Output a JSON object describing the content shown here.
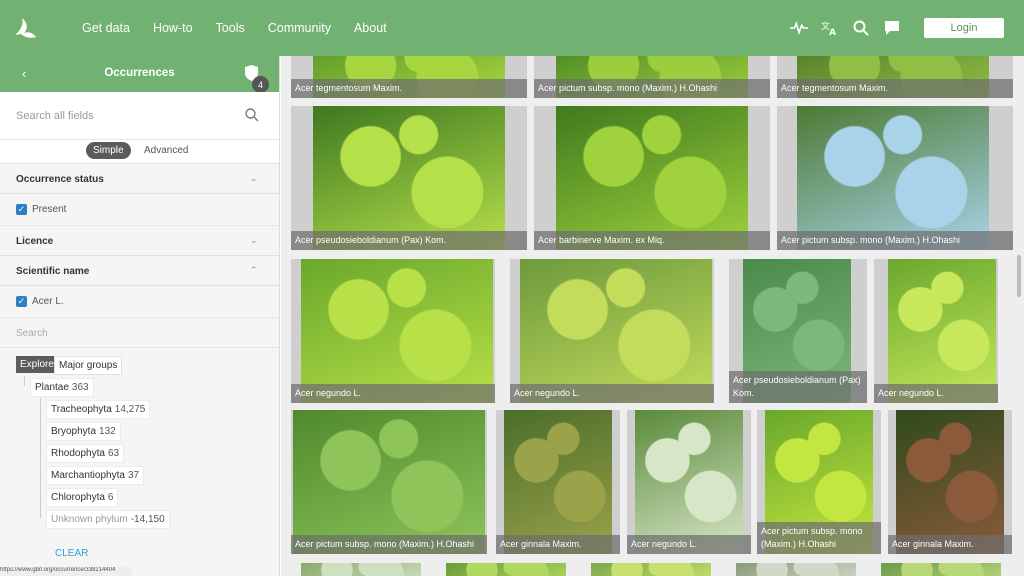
{
  "nav": {
    "items": [
      "Get data",
      "How-to",
      "Tools",
      "Community",
      "About"
    ],
    "login_label": "Login",
    "icons": [
      "logo-icon",
      "activity-icon",
      "translate-icon",
      "search-icon",
      "feedback-icon"
    ]
  },
  "sidebar": {
    "back_icon": "chevron-left-icon",
    "title": "Occurrences",
    "badge_count": "4",
    "search_placeholder": "Search all fields",
    "mode_simple": "Simple",
    "mode_advanced": "Advanced",
    "facets": {
      "occurrence_status": {
        "label": "Occurrence status",
        "selected": "Present"
      },
      "licence": {
        "label": "Licence"
      },
      "scientific_name": {
        "label": "Scientific name",
        "selected": "Acer L.",
        "search_placeholder": "Search"
      }
    },
    "taxonomy": {
      "explore_label": "Explore",
      "major_groups_label": "Major groups",
      "root": {
        "name": "Plantae",
        "count": "363"
      },
      "children": [
        {
          "name": "Tracheophyta",
          "count": "14,275"
        },
        {
          "name": "Bryophyta",
          "count": "132"
        },
        {
          "name": "Rhodophyta",
          "count": "63"
        },
        {
          "name": "Marchantiophyta",
          "count": "37"
        },
        {
          "name": "Chlorophyta",
          "count": "6"
        },
        {
          "name": "Unknown phylum",
          "count": "-14,150"
        }
      ]
    },
    "clear_label": "CLEAR",
    "status_url": "https://www.gbif.org/occurrence/338214404"
  },
  "gallery": {
    "cards": [
      {
        "caption": "Acer tegmentosum Maxim.",
        "bg": "#5f9a2a",
        "fg": "#a8d640"
      },
      {
        "caption": "Acer pictum subsp. mono (Maxim.) H.Ohashi",
        "bg": "#4d8a25",
        "fg": "#9ccd3c"
      },
      {
        "caption": "Acer tegmentosum Maxim.",
        "bg": "#557f2c",
        "fg": "#8fbf44"
      },
      {
        "caption": "Acer pseudosieboldianum (Pax) Kom.",
        "bg": "#3e7820",
        "fg": "#b6e04a"
      },
      {
        "caption": "Acer barbinerve Maxim. ex Miq.",
        "bg": "#3f7a1e",
        "fg": "#9fd23c"
      },
      {
        "caption": "Acer pictum subsp. mono (Maxim.) H.Ohashi",
        "bg": "#4c7a33",
        "fg": "#a9d3e8"
      },
      {
        "caption": "Acer negundo L.",
        "bg": "#6aa82b",
        "fg": "#b8e048"
      },
      {
        "caption": "Acer negundo L.",
        "bg": "#6d9a3c",
        "fg": "#c3dc5c"
      },
      {
        "caption": "Acer pseudosieboldianum (Pax) Kom.",
        "bg": "#4a8a4a",
        "fg": "#7cb87a"
      },
      {
        "caption": "Acer negundo L.",
        "bg": "#6aa82e",
        "fg": "#c6e85a"
      },
      {
        "caption": "Acer pictum subsp. mono (Maxim.) H.Ohashi",
        "bg": "#4f8a2c",
        "fg": "#8ec45a"
      },
      {
        "caption": "Acer ginnala Maxim.",
        "bg": "#4b6e2a",
        "fg": "#9aa24a"
      },
      {
        "caption": "Acer negundo L.",
        "bg": "#5a8a3a",
        "fg": "#d8e6c8"
      },
      {
        "caption": "Acer pictum subsp. mono (Maxim.) H.Ohashi",
        "bg": "#6aa82a",
        "fg": "#c4e640"
      },
      {
        "caption": "Acer ginnala Maxim.",
        "bg": "#2f4a1c",
        "fg": "#8a5a3a"
      },
      {
        "caption": "",
        "bg": "#8aa86a",
        "fg": "#cfe0c0"
      },
      {
        "caption": "",
        "bg": "#6a9a3a",
        "fg": "#b0d860"
      },
      {
        "caption": "",
        "bg": "#7aa84a",
        "fg": "#c8e070"
      },
      {
        "caption": "",
        "bg": "#8a9a7a",
        "fg": "#d0d8c8"
      },
      {
        "caption": "",
        "bg": "#6a9a4a",
        "fg": "#b8d878"
      }
    ]
  }
}
